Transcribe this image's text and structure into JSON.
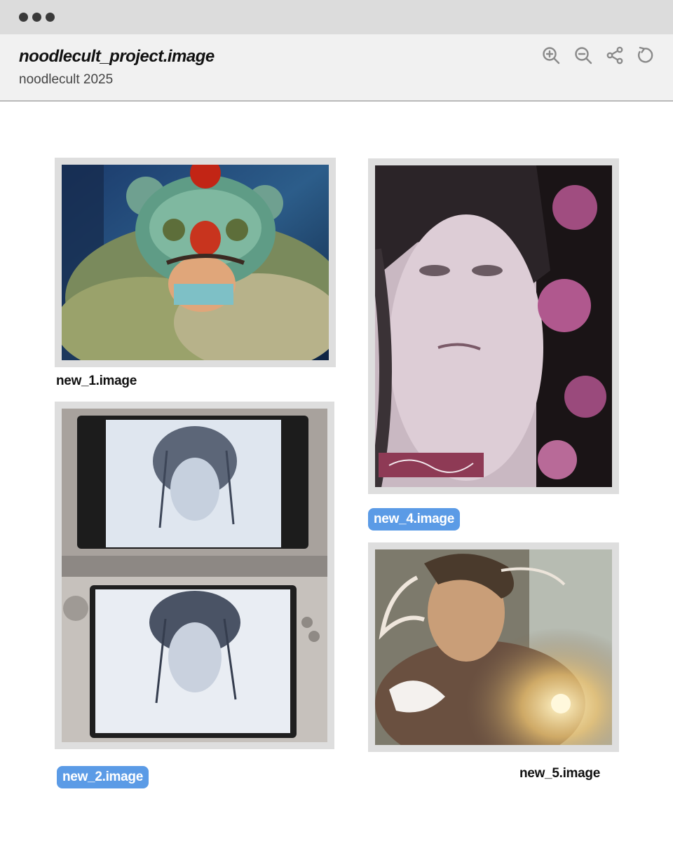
{
  "window": {
    "title": "noodlecult_project.image",
    "subtitle": "noodlecult 2025",
    "toolbar": [
      "zoom-in-icon",
      "zoom-out-icon",
      "share-icon",
      "refresh-icon"
    ]
  },
  "images": [
    {
      "label": "new_1.image",
      "highlighted": false
    },
    {
      "label": "new_2.image",
      "highlighted": true
    },
    {
      "label": "new_4.image",
      "highlighted": true
    },
    {
      "label": "new_5.image",
      "highlighted": false
    }
  ],
  "colors": {
    "titlebar": "#dcdcdc",
    "header": "#f1f1f1",
    "frame": "#dedede",
    "chip": "#5b9be6"
  }
}
